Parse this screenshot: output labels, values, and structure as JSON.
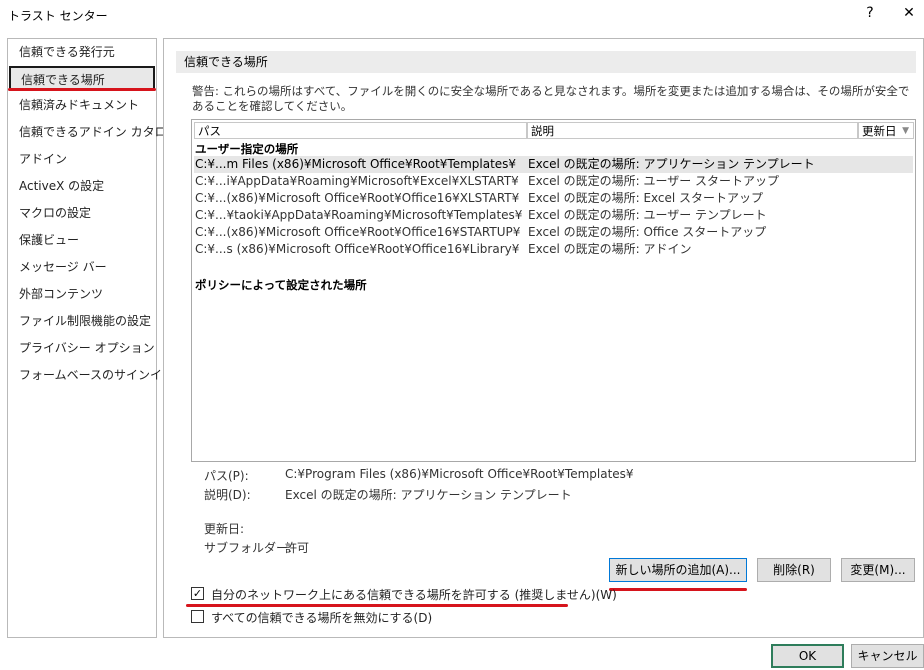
{
  "window": {
    "title": "トラスト センター",
    "help": "?",
    "close": "✕"
  },
  "nav": {
    "items": [
      "信頼できる発行元",
      "信頼できる場所",
      "信頼済みドキュメント",
      "信頼できるアドイン カタログ",
      "アドイン",
      "ActiveX の設定",
      "マクロの設定",
      "保護ビュー",
      "メッセージ バー",
      "外部コンテンツ",
      "ファイル制限機能の設定",
      "プライバシー オプション",
      "フォームベースのサインイン"
    ],
    "selected_index": 1
  },
  "section": {
    "title": "信頼できる場所",
    "warning": "警告: これらの場所はすべて、ファイルを開くのに安全な場所であると見なされます。場所を変更または追加する場合は、その場所が安全であることを確認してください。"
  },
  "table": {
    "columns": [
      "パス",
      "説明",
      "更新日"
    ],
    "sort_icon": "▼",
    "user_group": "ユーザー指定の場所",
    "rows": [
      {
        "path": "C:¥...m Files (x86)¥Microsoft Office¥Root¥Templates¥",
        "desc": "Excel の既定の場所: アプリケーション テンプレート"
      },
      {
        "path": "C:¥...i¥AppData¥Roaming¥Microsoft¥Excel¥XLSTART¥",
        "desc": "Excel の既定の場所: ユーザー スタートアップ"
      },
      {
        "path": "C:¥...(x86)¥Microsoft Office¥Root¥Office16¥XLSTART¥",
        "desc": "Excel の既定の場所: Excel スタートアップ"
      },
      {
        "path": "C:¥...¥taoki¥AppData¥Roaming¥Microsoft¥Templates¥",
        "desc": "Excel の既定の場所: ユーザー テンプレート"
      },
      {
        "path": "C:¥...(x86)¥Microsoft Office¥Root¥Office16¥STARTUP¥",
        "desc": "Excel の既定の場所: Office スタートアップ"
      },
      {
        "path": "C:¥...s (x86)¥Microsoft Office¥Root¥Office16¥Library¥",
        "desc": "Excel の既定の場所: アドイン"
      }
    ],
    "selected_row": 0,
    "policy_group": "ポリシーによって設定された場所"
  },
  "details": {
    "path_label": "パス(P):",
    "path_value": "C:¥Program Files (x86)¥Microsoft Office¥Root¥Templates¥",
    "desc_label": "説明(D):",
    "desc_value": "Excel の既定の場所: アプリケーション テンプレート",
    "modified_label": "更新日:",
    "modified_value": "",
    "subfolders_label": "サブフォルダー:",
    "subfolders_value": "許可"
  },
  "buttons": {
    "add": "新しい場所の追加(A)...",
    "remove": "削除(R)",
    "modify": "変更(M)...",
    "ok": "OK",
    "cancel": "キャンセル"
  },
  "checkboxes": {
    "network": {
      "label": "自分のネットワーク上にある信頼できる場所を許可する (推奨しません)(W)",
      "checked": true,
      "mark": "✓"
    },
    "disable_all": {
      "label": "すべての信頼できる場所を無効にする(D)",
      "checked": false,
      "mark": ""
    }
  },
  "colors": {
    "highlight_red": "#d6141c",
    "ok_border": "#2e7d5b"
  }
}
